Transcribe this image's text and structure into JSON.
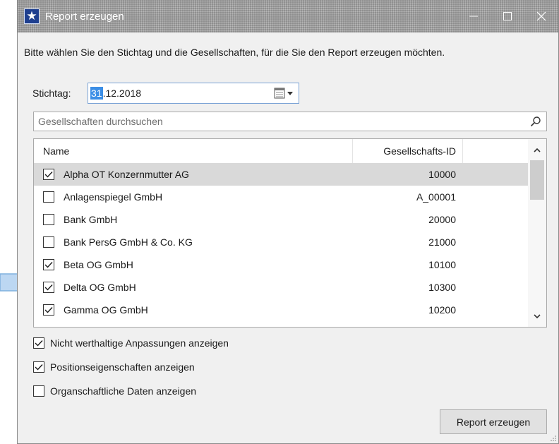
{
  "window": {
    "title": "Report erzeugen",
    "minimize_glyph": "minimize-icon",
    "maximize_glyph": "maximize-icon",
    "close_glyph": "close-icon"
  },
  "intro_text": "Bitte wählen Sie den Stichtag und die Gesellschaften, für die Sie den Report erzeugen möchten.",
  "date": {
    "label": "Stichtag:",
    "day": "31",
    "rest": ".12.2018",
    "dropdown_icon": "calendar-dropdown-icon"
  },
  "search": {
    "placeholder": "Gesellschaften durchsuchen",
    "value": "",
    "icon": "search-icon"
  },
  "list": {
    "columns": {
      "name": "Name",
      "id": "Gesellschafts-ID"
    },
    "rows": [
      {
        "name": "Alpha OT Konzernmutter AG",
        "id": "10000",
        "checked": true,
        "selected": true
      },
      {
        "name": "Anlagenspiegel GmbH",
        "id": "A_00001",
        "checked": false,
        "selected": false
      },
      {
        "name": "Bank GmbH",
        "id": "20000",
        "checked": false,
        "selected": false
      },
      {
        "name": "Bank PersG GmbH & Co. KG",
        "id": "21000",
        "checked": false,
        "selected": false
      },
      {
        "name": "Beta OG GmbH",
        "id": "10100",
        "checked": true,
        "selected": false
      },
      {
        "name": "Delta OG GmbH",
        "id": "10300",
        "checked": true,
        "selected": false
      },
      {
        "name": "Gamma OG GmbH",
        "id": "10200",
        "checked": true,
        "selected": false
      }
    ]
  },
  "options": [
    {
      "label": "Nicht werthaltige Anpassungen anzeigen",
      "checked": true
    },
    {
      "label": "Positionseigenschaften anzeigen",
      "checked": true
    },
    {
      "label": "Organschaftliche Daten anzeigen",
      "checked": false
    }
  ],
  "submit_label": "Report erzeugen",
  "colors": {
    "accent": "#3b8ee6",
    "pointer_fill": "#bcd7f2",
    "pointer_stroke": "#7fb0de",
    "selected_row": "#d9d9d9"
  }
}
